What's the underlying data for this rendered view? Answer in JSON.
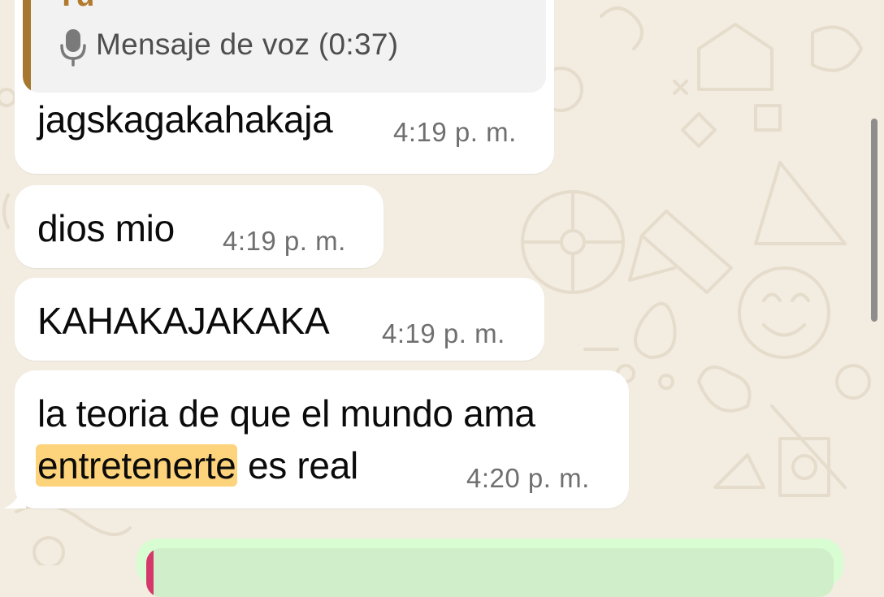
{
  "colors": {
    "wallpaper": "#f2ece1",
    "doodle": "#e6dccc",
    "bubble_in": "#ffffff",
    "bubble_out": "#d9fdd3",
    "quote_bar": "#a6782f",
    "highlight": "#fdd37b"
  },
  "messages": {
    "reply": {
      "author": "Tú",
      "icon": "mic-icon",
      "text": "Mensaje de voz (0:37)"
    },
    "m1": {
      "text": "jagskagakahakaja",
      "time": "4:19 p. m."
    },
    "m2": {
      "text": "dios mio",
      "time": "4:19 p. m."
    },
    "m3": {
      "text": "KAHAKAJAKAKA",
      "time": "4:19 p. m."
    },
    "m4": {
      "line1": "la teoria de que el mundo ama",
      "highlight": "entretenerte",
      "rest": " es real",
      "time": "4:20 p. m."
    }
  }
}
